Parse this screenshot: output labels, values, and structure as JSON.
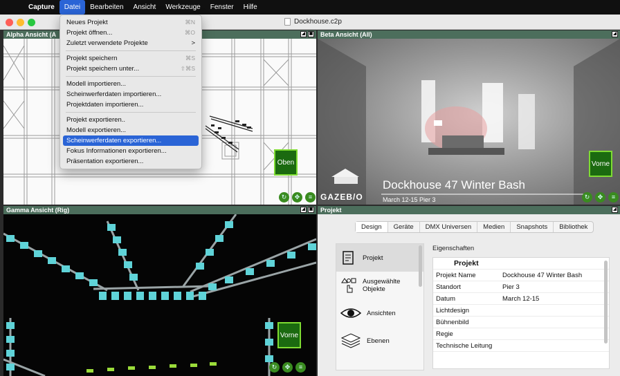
{
  "menubar": {
    "app": "Capture",
    "items": [
      "Datei",
      "Bearbeiten",
      "Ansicht",
      "Werkzeuge",
      "Fenster",
      "Hilfe"
    ]
  },
  "window": {
    "title": "Dockhouse.c2p"
  },
  "menu": {
    "groups": [
      [
        {
          "label": "Neues Projekt",
          "shortcut": "⌘N"
        },
        {
          "label": "Projekt öffnen...",
          "shortcut": "⌘O"
        },
        {
          "label": "Zuletzt verwendete Projekte",
          "shortcut": ">"
        }
      ],
      [
        {
          "label": "Projekt speichern",
          "shortcut": "⌘S"
        },
        {
          "label": "Projekt speichern unter...",
          "shortcut": "⇧⌘S"
        }
      ],
      [
        {
          "label": "Modell importieren...",
          "shortcut": ""
        },
        {
          "label": "Scheinwerferdaten importieren...",
          "shortcut": ""
        },
        {
          "label": "Projektdaten importieren...",
          "shortcut": ""
        }
      ],
      [
        {
          "label": "Projekt exportieren..",
          "shortcut": ""
        },
        {
          "label": "Modell exportieren...",
          "shortcut": ""
        },
        {
          "label": "Scheinwerferdaten exportieren...",
          "shortcut": "",
          "highlighted": true
        },
        {
          "label": "Fokus Informationen exportieren...",
          "shortcut": ""
        },
        {
          "label": "Präsentation exportieren...",
          "shortcut": ""
        }
      ]
    ]
  },
  "panes": {
    "alpha": {
      "title": "Alpha Ansicht  (A",
      "view_button": "Oben"
    },
    "beta": {
      "title": "Beta Ansicht  (All)",
      "view_button": "Vorne",
      "logo": "GAZEB/O",
      "event_title": "Dockhouse 47 Winter Bash",
      "event_sub": "March 12-15 Pier 3"
    },
    "gamma": {
      "title": "Gamma Ansicht  (Rig)",
      "view_button": "Vorne"
    },
    "project": {
      "title": "Projekt"
    }
  },
  "project_panel": {
    "tabs": [
      "Design",
      "Geräte",
      "DMX Universen",
      "Medien",
      "Snapshots",
      "Bibliothek"
    ],
    "categories": [
      {
        "label": "Projekt",
        "icon": "document-icon"
      },
      {
        "label": "Ausgewählte Objekte",
        "icon": "selection-icon"
      },
      {
        "label": "Ansichten",
        "icon": "eye-icon"
      },
      {
        "label": "Ebenen",
        "icon": "layers-icon"
      }
    ],
    "properties_label": "Eigenschaften",
    "table_header": "Projekt",
    "rows": [
      {
        "key": "Projekt Name",
        "value": "Dockhouse 47 Winter Bash"
      },
      {
        "key": "Standort",
        "value": "Pier 3"
      },
      {
        "key": "Datum",
        "value": "March 12-15"
      },
      {
        "key": "Lichtdesign",
        "value": ""
      },
      {
        "key": "Bühnenbild",
        "value": ""
      },
      {
        "key": "Regie",
        "value": ""
      },
      {
        "key": "Technische Leitung",
        "value": ""
      }
    ]
  },
  "colors": {
    "accent": "#2a64d6",
    "pane_header": "#4c6e5c",
    "view_button": "#1b6a10",
    "fixture": "#5fd3d8"
  }
}
